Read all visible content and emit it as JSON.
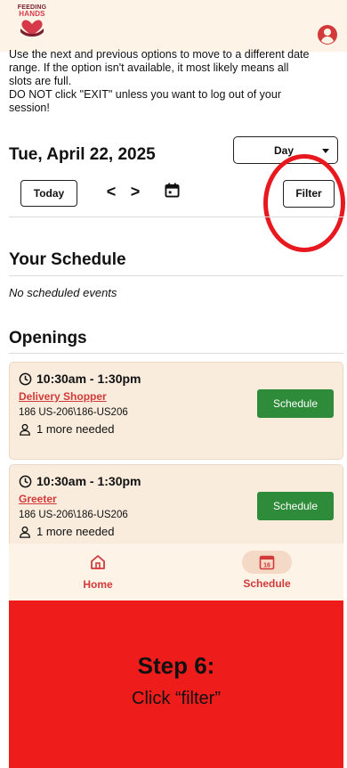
{
  "header": {
    "logo_line1": "FEEDING",
    "logo_line2": "HANDS"
  },
  "instructions": {
    "line1": "Use the next and previous options to move to a different date",
    "line2": "range.  If the option isn't available, it most likely means all",
    "line3": "slots are full.",
    "line4": "DO NOT click \"EXIT\" unless you want to log out of your",
    "line5": "session!"
  },
  "date_bar": {
    "date": "Tue, April 22, 2025",
    "view_value": "Day",
    "today_label": "Today",
    "prev_label": "<",
    "next_label": ">",
    "filter_label": "Filter"
  },
  "schedule": {
    "title": "Your Schedule",
    "empty_text": "No scheduled events"
  },
  "openings": {
    "title": "Openings",
    "items": [
      {
        "time": "10:30am - 1:30pm",
        "role": "Delivery Shopper",
        "address": "186 US-206\\186-US206",
        "needed": "1 more needed",
        "button": "Schedule"
      },
      {
        "time": "10:30am - 1:30pm",
        "role": "Greeter",
        "address": "186 US-206\\186-US206",
        "needed": "1 more needed",
        "button": "Schedule"
      }
    ]
  },
  "bottom_nav": {
    "home_label": "Home",
    "schedule_label": "Schedule",
    "calendar_day": "16"
  },
  "step": {
    "title": "Step 6:",
    "subtitle": "Click “filter”"
  },
  "colors": {
    "header_bg": "#fdf3e6",
    "card_bg": "#f9ecdd",
    "accent_red": "#d23a3a",
    "button_green": "#2e8b3a",
    "banner_red": "#ef1c1c",
    "highlight_red": "#e8181f"
  },
  "icons": {
    "logo": "feeding-hands-logo",
    "account": "account-circle-icon",
    "calendar": "calendar-icon",
    "clock": "clock-icon",
    "person": "person-icon",
    "home": "home-icon",
    "schedule": "calendar-day-icon"
  }
}
